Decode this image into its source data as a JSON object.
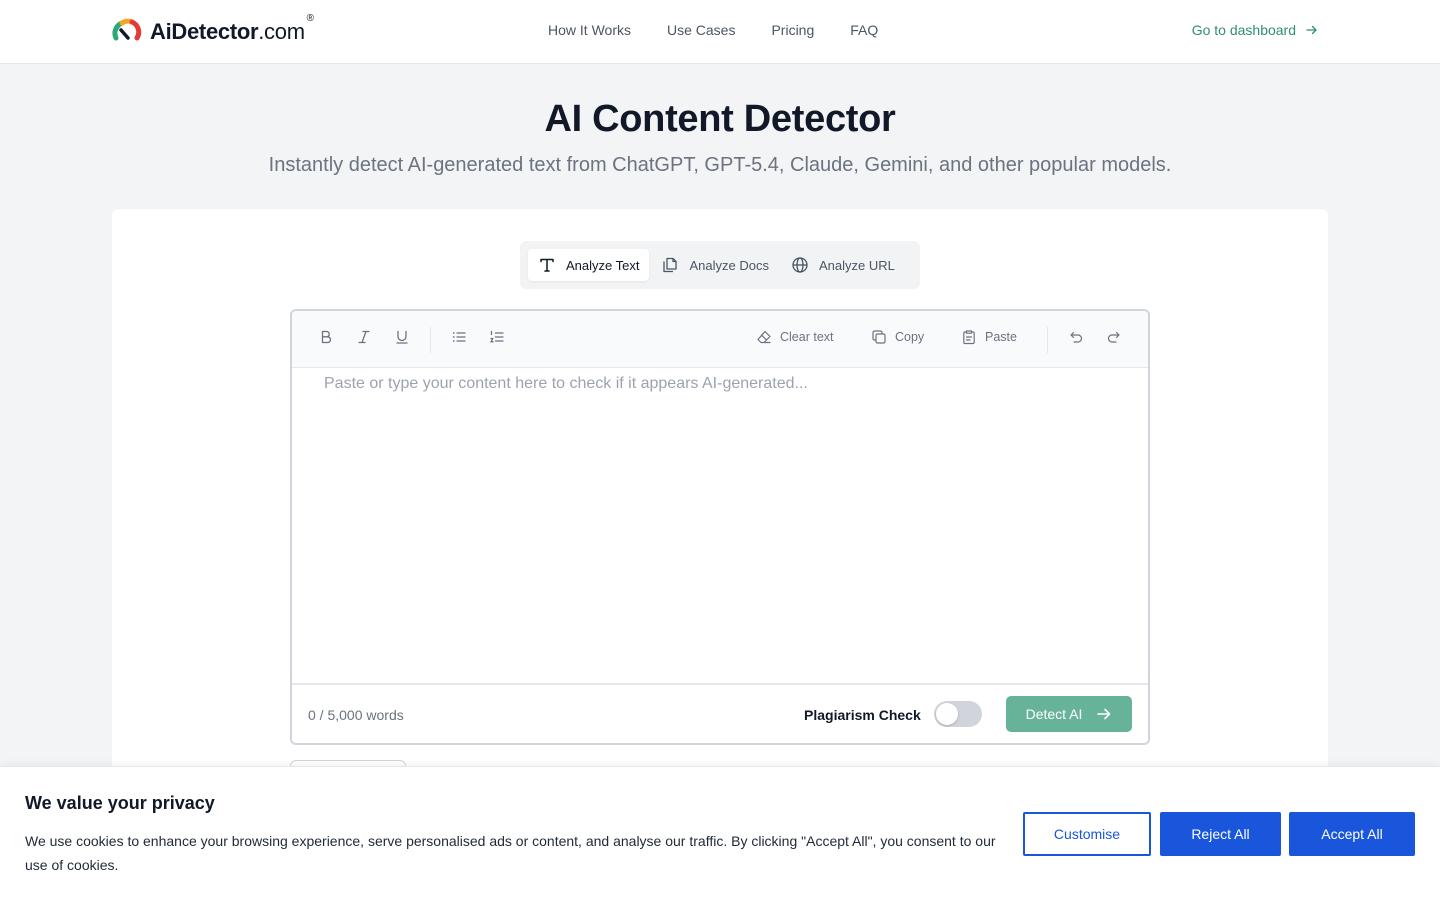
{
  "header": {
    "logo_main": "AiDetector",
    "logo_suffix": ".com",
    "logo_reg": "®",
    "nav": [
      "How It Works",
      "Use Cases",
      "Pricing",
      "FAQ"
    ],
    "dashboard_link": "Go to dashboard"
  },
  "hero": {
    "title": "AI Content Detector",
    "subtitle": "Instantly detect AI-generated text from ChatGPT, GPT-5.4, Claude, Gemini, and other popular models."
  },
  "mode_tabs": [
    {
      "label": "Analyze Text",
      "icon": "text-icon",
      "active": true
    },
    {
      "label": "Analyze Docs",
      "icon": "docs-icon",
      "active": false
    },
    {
      "label": "Analyze URL",
      "icon": "globe-icon",
      "active": false
    }
  ],
  "toolbar": {
    "clear": "Clear text",
    "copy": "Copy",
    "paste": "Paste"
  },
  "editor": {
    "placeholder": "Paste or type your content here to check if it appears AI-generated...",
    "word_count": "0 / 5,000 words",
    "plagiarism_label": "Plagiarism Check",
    "plagiarism_enabled": false,
    "detect_label": "Detect AI"
  },
  "cookie": {
    "title": "We value your privacy",
    "text": "We use cookies to enhance your browsing experience, serve personalised ads or content, and analyse our traffic. By clicking \"Accept All\", you consent to our use of cookies.",
    "customise": "Customise",
    "reject": "Reject All",
    "accept": "Accept All"
  },
  "colors": {
    "accent": "#2f8f6f",
    "detect_button": "#67b39a",
    "cookie_primary": "#1a56db"
  }
}
